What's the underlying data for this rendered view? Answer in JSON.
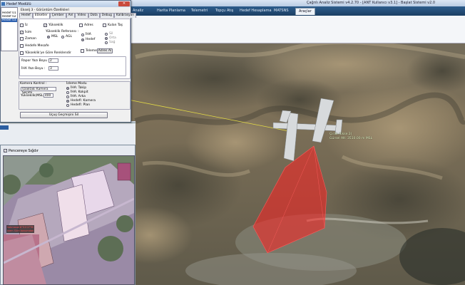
{
  "app": {
    "title": "Çağrılı Analiz Sistemi v4.2.70  -  [ANT Kullanıcı v3.1]  -  Başlat Sistemi v2.0"
  },
  "main_tabs": [
    "Analiz",
    "Harita Planlama",
    "Telemetri",
    "Topçu Atış",
    "Hedef Hesaplama",
    "MATSNS",
    "Araçlar"
  ],
  "main_active_tab": "Araçlar",
  "dialog": {
    "title": "Hedef Modülü",
    "close": "✕",
    "list_items": [
      "",
      "Hedef 01",
      "Hedef 02",
      "Hedef 03"
    ],
    "subtitle": "Ekselj 3 - Görüntüm Özellikleri",
    "tabs": [
      "Hedef",
      "Etiketler",
      "Çember",
      "Anl",
      "Video",
      "Data",
      "Debug",
      "Kalibrasyon"
    ],
    "active_tab": "Etiketler",
    "checks": {
      "iz": "İz",
      "isim": "İsim",
      "zaman": "Zaman",
      "hedefe_mesafe": "Hedefe Mesafe",
      "yukseklik_renk": "Yükseklik'ye Göre Renklendir",
      "yukseklik": "Yükseklik",
      "adres": "Adres",
      "kulan_tas": "Kulan Taş"
    },
    "yukseklik_referansi": "Yükseklik Referansı :",
    "msl": "MSL",
    "agl": "AGL",
    "iha": "İHA",
    "hedef": "Hedef",
    "sil": "Sil",
    "orta": "Orta",
    "sag": "Sağ",
    "telemetri": "Telemetri",
    "adres_al": "Adres Al",
    "rapor_yazi": "Rapor Yazı Boyu :",
    "iha_yazi": "İHA Yazı Boyu :",
    "rapor_val": "2",
    "iha_val": "3",
    "kamera_kontrol": "Kamera Kontrol :",
    "kamera_select": "Uzaktaki Kamera Seçimi",
    "yukseklik_msl": "Yükseklik(MSL) :",
    "yukseklik_msl_val": "400",
    "isleme_modu": "İzleme Modu",
    "modes": [
      "İHA: Takip",
      "İHA: Kokpit",
      "İHA: Arka",
      "Hedefi: Kamera",
      "Hedefi: Plan"
    ],
    "modes_on": [
      true,
      false,
      false,
      true,
      false
    ],
    "apply": "Uçuş Geçmişini Sil"
  },
  "camera_panel": {
    "checkbox_label": "Pencereye Sığdır",
    "overlay_line1": "Sokmasal 8°51'07\"M",
    "overlay_line2": "Ivem Süm konumdan"
  },
  "map": {
    "aircraft_label": "Çirak (Ekse 2)",
    "aircraft_info": "Gürsel Alt: 3510.00 m MSL"
  },
  "colors": {
    "title_gradient_top": "#dbe6f4",
    "tabbar": "#2d5d8c",
    "footprint": "#ff2020",
    "selection": "#2f62b0"
  }
}
